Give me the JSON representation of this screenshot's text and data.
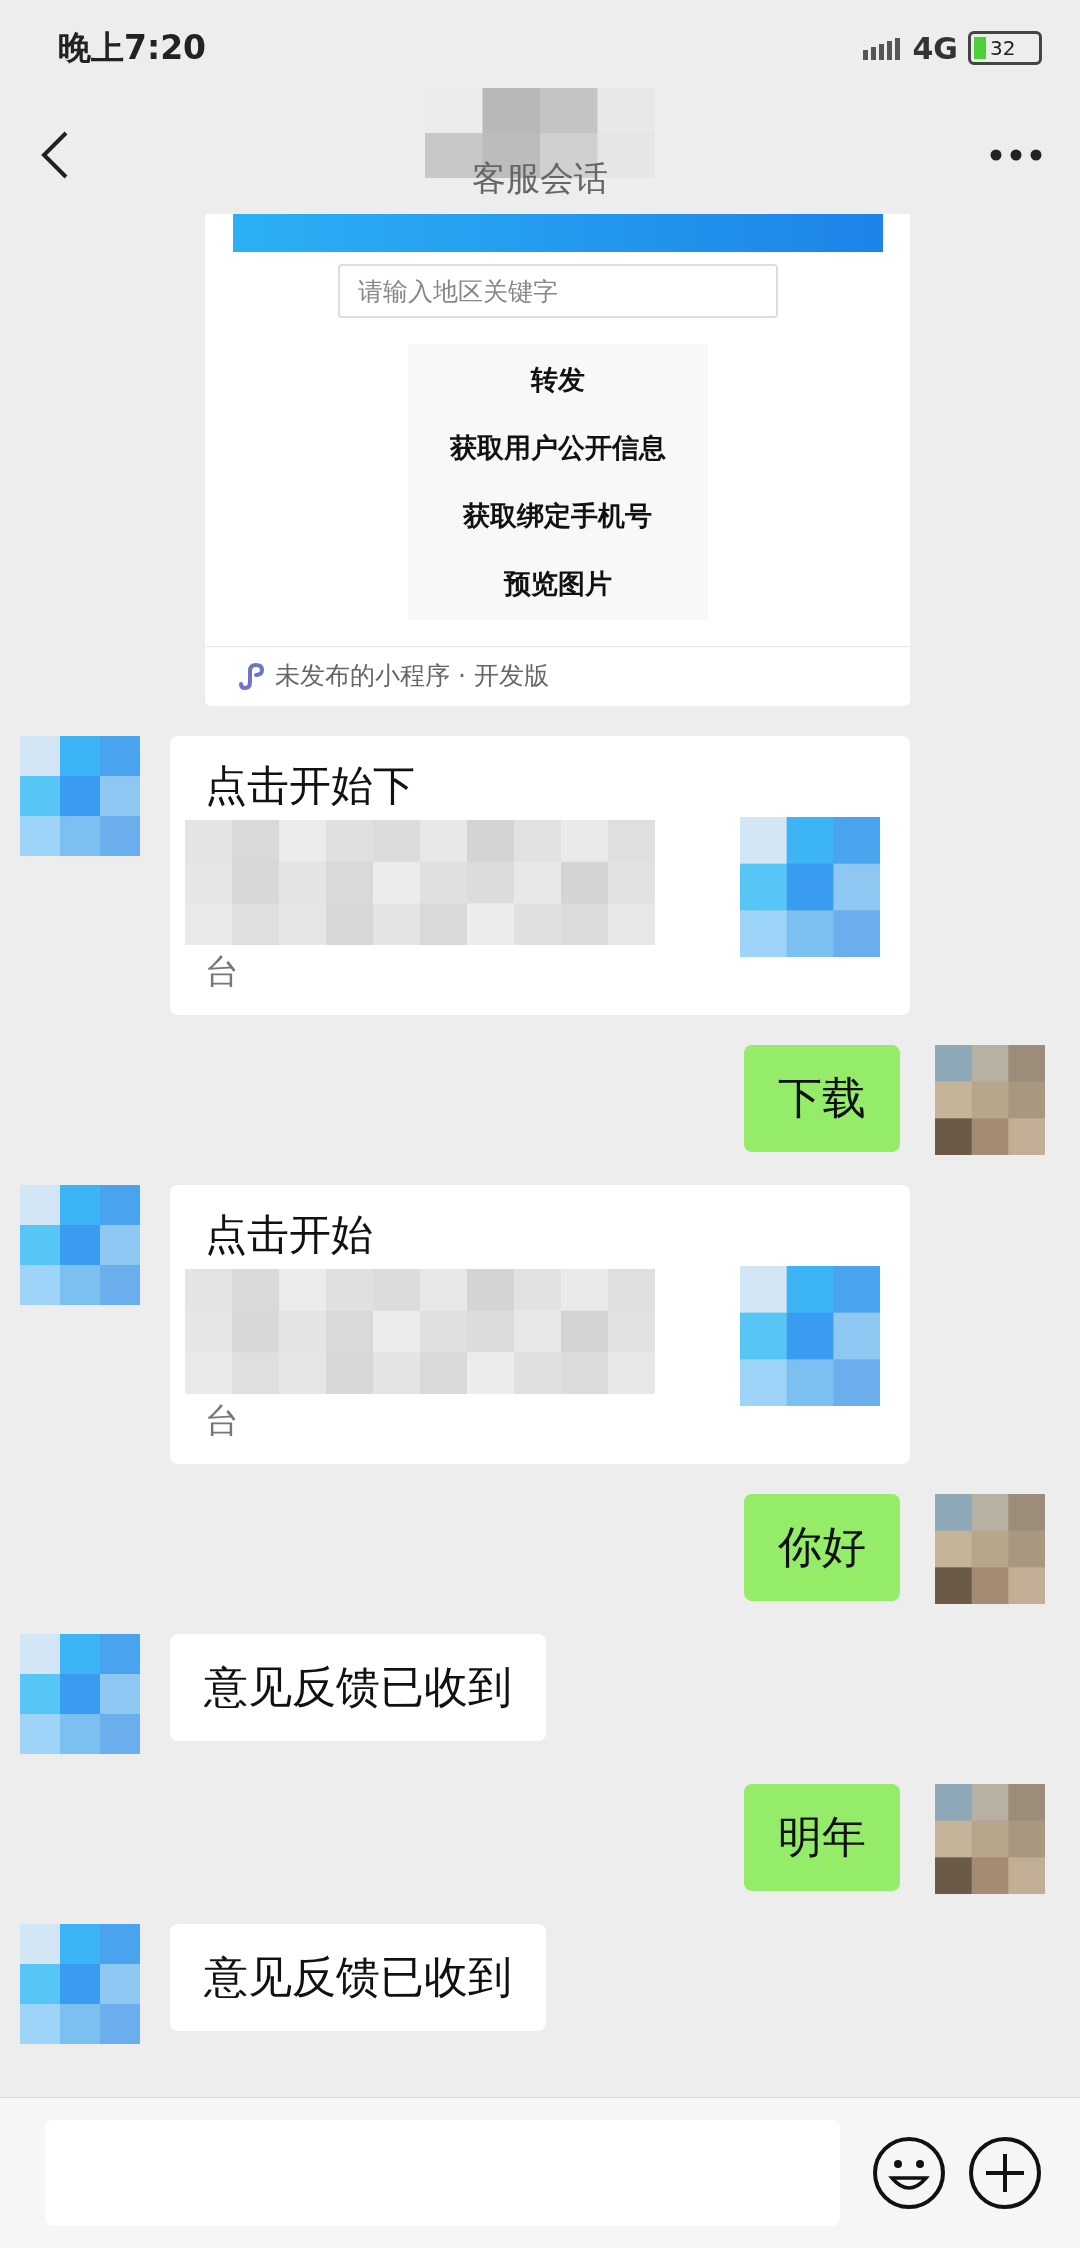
{
  "status_bar": {
    "time": "晚上7:20",
    "network": "4G",
    "battery": "32"
  },
  "header": {
    "title": "客服会话"
  },
  "messages": [
    {
      "kind": "mini_program",
      "search_placeholder": "请输入地区关键字",
      "menu_items": [
        "转发",
        "获取用户公开信息",
        "获取绑定手机号",
        "预览图片"
      ],
      "footer": "未发布的小程序 · 开发版"
    },
    {
      "kind": "link_card",
      "title": "点击开始下",
      "description_end": "台"
    },
    {
      "kind": "sent_text",
      "text": "下载"
    },
    {
      "kind": "link_card",
      "title": "点击开始",
      "description_end": "台"
    },
    {
      "kind": "sent_text",
      "text": "你好"
    },
    {
      "kind": "received_text",
      "text": "意见反馈已收到"
    },
    {
      "kind": "sent_text",
      "text": "明年"
    },
    {
      "kind": "received_text",
      "text": "意见反馈已收到"
    }
  ]
}
